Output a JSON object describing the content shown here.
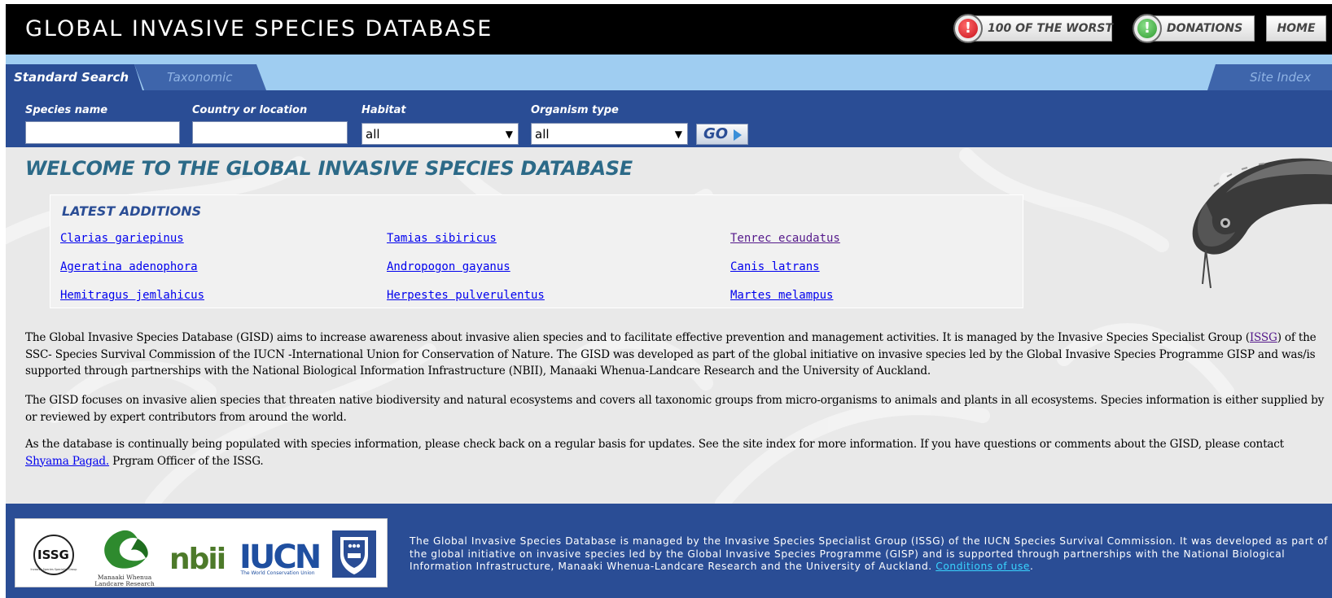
{
  "header": {
    "site_title": "GLOBAL INVASIVE SPECIES DATABASE",
    "buttons": {
      "worst": "100 OF THE WORST",
      "donations": "DONATIONS",
      "home": "HOME"
    },
    "button_icon_glyph": "!"
  },
  "tabs": {
    "standard": "Standard Search",
    "taxonomic": "Taxonomic",
    "site_index": "Site Index"
  },
  "search": {
    "species_label": "Species name",
    "species_value": "",
    "country_label": "Country or location",
    "country_value": "",
    "habitat_label": "Habitat",
    "habitat_value": "all",
    "organism_label": "Organism type",
    "organism_value": "all",
    "dropdown_glyph": "▼",
    "go_label": "GO"
  },
  "main": {
    "welcome_title": "WELCOME TO THE GLOBAL INVASIVE SPECIES DATABASE",
    "latest_title": "LATEST ADDITIONS",
    "latest": [
      "Clarias gariepinus",
      "Tamias sibiricus",
      "Tenrec ecaudatus",
      "Ageratina adenophora",
      "Andropogon gayanus",
      "Canis latrans",
      "Hemitragus jemlahicus",
      "Herpestes pulverulentus",
      "Martes melampus"
    ],
    "intro": {
      "before": "The Global Invasive Species Database (GISD) aims to increase awareness about invasive alien species and to facilitate effective prevention and management activities. It is managed by the Invasive Species Specialist Group (",
      "link": "ISSG",
      "after": ") of the SSC- Species Survival Commission of the IUCN -International Union for Conservation of Nature. The GISD was developed as part of the global initiative on invasive species led by the Global Invasive Species Programme GISP and was/is supported through partnerships with the National Biological Information Infrastructure (NBII), Manaaki Whenua-Landcare Research and the University of Auckland."
    },
    "focus": "The GISD focuses on invasive alien species that threaten native biodiversity and natural ecosystems and covers all taxonomic groups from micro-organisms to animals and plants in all ecosystems. Species information is either supplied by or reviewed by expert contributors from around the world.",
    "update": {
      "before": "As the database is continually being populated with species information, please check back on a regular basis for updates. See the site index for more information. If you have questions or comments about the GISD, please contact ",
      "link": "Shyama Pagad.",
      "after": " Prgram Officer of the ISSG."
    }
  },
  "footer": {
    "logos": {
      "issg": "ISSG",
      "issg_sub": "Invasive Species Specialist Group",
      "manaaki_line1": "Manaaki Whenua",
      "manaaki_line2": "Landcare Research",
      "nbii": "nbii",
      "iucn": "IUCN",
      "iucn_sub": "The World Conservation Union"
    },
    "text": "The Global Invasive Species Database is managed by the Invasive Species Specialist Group (ISSG) of the IUCN Species Survival Commission. It was developed as part of the global initiative on invasive species led by the Global Invasive Species Programme (GISP) and is supported through partnerships with the National Biological Information Infrastructure, Manaaki Whenua-Landcare Research and the University of Auckland. ",
    "conditions_link": "Conditions of use",
    "end": "."
  },
  "colors": {
    "header_bg": "#000000",
    "tabbar_bg": "#9fcdf1",
    "nav_blue": "#2a4d95",
    "title_teal": "#2c6a88",
    "worst_icon": "#d8202a",
    "donations_icon": "#3aa63a",
    "footer_link": "#39d4ff"
  },
  "icons": {
    "worst": "red-alert-icon",
    "donations": "green-alert-icon",
    "go": "play-arrow-icon"
  }
}
